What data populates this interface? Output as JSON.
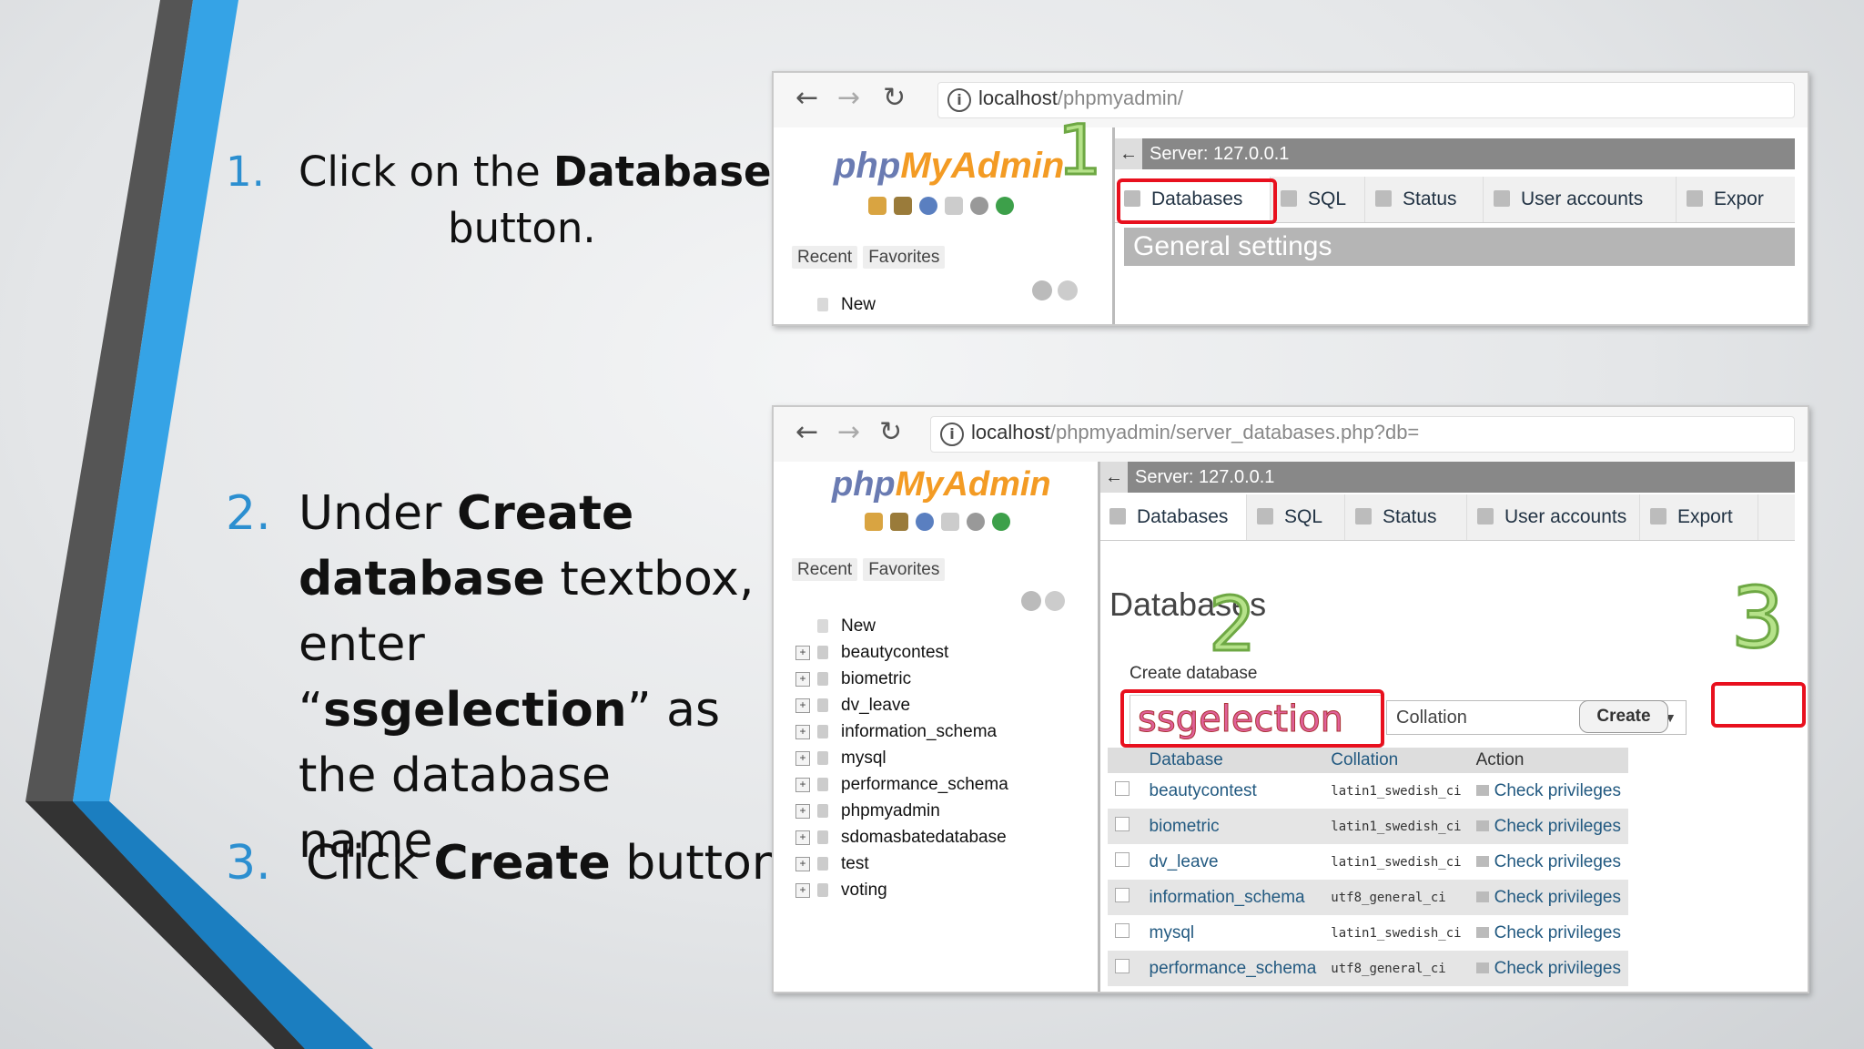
{
  "steps": [
    {
      "num": "1.",
      "pre": "Click on the ",
      "bold": "Databases",
      "post": "button."
    },
    {
      "num": "2.",
      "pre": "Under ",
      "bold1": "Create database",
      "mid": " textbox, enter “",
      "bold2": "ssgelection",
      "post": "” as the database name."
    },
    {
      "num": "3.",
      "pre": "Click ",
      "bold": "Create",
      "post": " button."
    }
  ],
  "shot1": {
    "url_host": "localhost",
    "url_rest": "/phpmyadmin/",
    "logo_php": "php",
    "logo_mya": "MyAdmin",
    "recent": "Recent",
    "favorites": "Favorites",
    "new": "New",
    "server": "Server: 127.0.0.1",
    "tabs": [
      "Databases",
      "SQL",
      "Status",
      "User accounts",
      "Expor"
    ],
    "general": "General settings",
    "marker": "1"
  },
  "shot2": {
    "url_host": "localhost",
    "url_rest": "/phpmyadmin/server_databases.php?db=",
    "logo_php": "php",
    "logo_mya": "MyAdmin",
    "recent": "Recent",
    "favorites": "Favorites",
    "tree": [
      "New",
      "beautycontest",
      "biometric",
      "dv_leave",
      "information_schema",
      "mysql",
      "performance_schema",
      "phpmyadmin",
      "sdomasbatedatabase",
      "test",
      "voting"
    ],
    "server": "Server: 127.0.0.1",
    "tabs": [
      "Databases",
      "SQL",
      "Status",
      "User accounts",
      "Export"
    ],
    "heading": "Databases",
    "create_label": "Create database",
    "db_input": "ssgelection",
    "collation": "Collation",
    "create_btn": "Create",
    "marker2": "2",
    "marker3": "3",
    "table_headers": [
      "Database",
      "Collation",
      "Action"
    ],
    "rows": [
      {
        "db": "beautycontest",
        "coll": "latin1_swedish_ci",
        "action": "Check privileges"
      },
      {
        "db": "biometric",
        "coll": "latin1_swedish_ci",
        "action": "Check privileges"
      },
      {
        "db": "dv_leave",
        "coll": "latin1_swedish_ci",
        "action": "Check privileges"
      },
      {
        "db": "information_schema",
        "coll": "utf8_general_ci",
        "action": "Check privileges"
      },
      {
        "db": "mysql",
        "coll": "latin1_swedish_ci",
        "action": "Check privileges"
      },
      {
        "db": "performance_schema",
        "coll": "utf8_general_ci",
        "action": "Check privileges"
      }
    ]
  }
}
